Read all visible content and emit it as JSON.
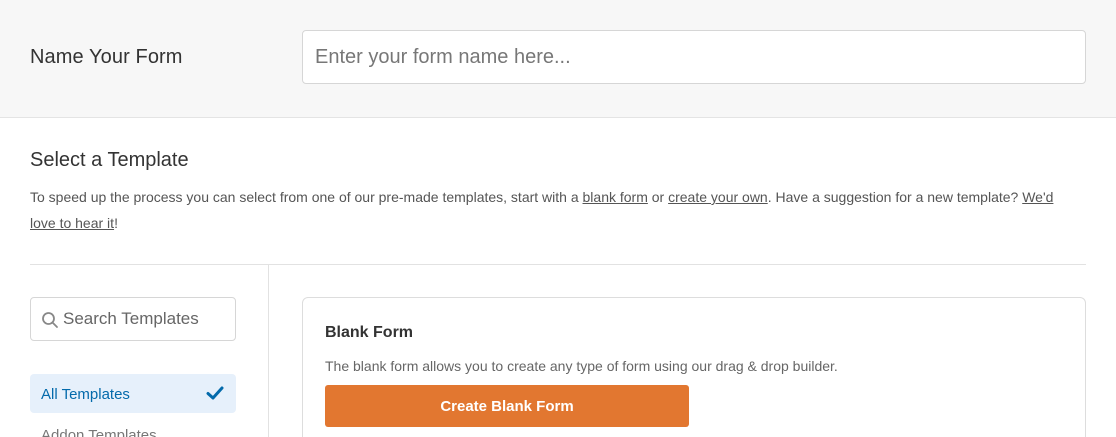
{
  "form_name": {
    "label": "Name Your Form",
    "value": "",
    "placeholder": "Enter your form name here..."
  },
  "template_section": {
    "title": "Select a Template",
    "desc_part1": "To speed up the process you can select from one of our pre-made templates, start with a ",
    "link_blank": "blank form",
    "desc_part2": " or ",
    "link_create": "create your own",
    "desc_part3": ". Have a suggestion for a new template? ",
    "link_suggest": "We'd love to hear it",
    "desc_part4": "!"
  },
  "sidebar": {
    "search_placeholder": "Search Templates",
    "search_icon": "search-icon",
    "categories": [
      {
        "label": "All Templates",
        "active": true,
        "icon": "checkmark-icon"
      },
      {
        "label": "Addon Templates",
        "active": false
      }
    ]
  },
  "blank_card": {
    "title": "Blank Form",
    "description": "The blank form allows you to create any type of form using our drag & drop builder.",
    "button_label": "Create Blank Form"
  },
  "colors": {
    "accent_orange": "#e27730",
    "active_blue": "#036aab",
    "active_bg": "#e6f0fb"
  }
}
